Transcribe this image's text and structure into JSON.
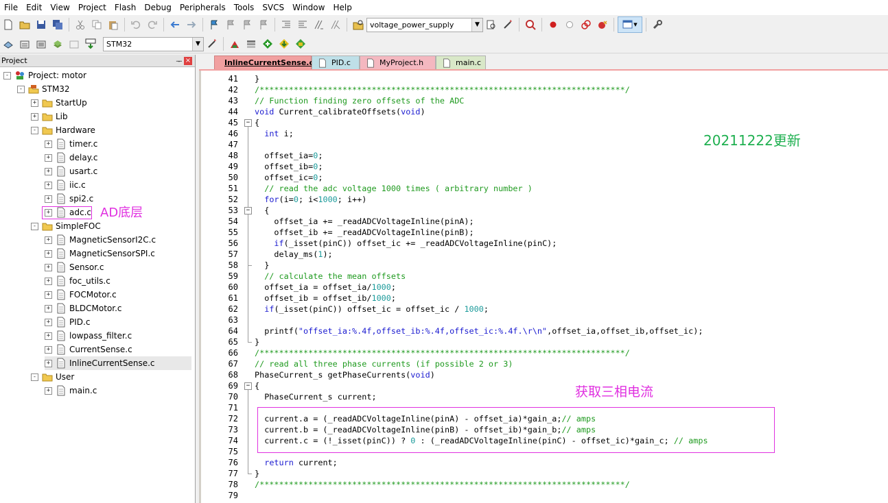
{
  "menu": [
    "File",
    "Edit",
    "View",
    "Project",
    "Flash",
    "Debug",
    "Peripherals",
    "Tools",
    "SVCS",
    "Window",
    "Help"
  ],
  "toolbar1": {
    "target_combo": "voltage_power_supply"
  },
  "toolbar2": {
    "device_combo": "STM32"
  },
  "panel": {
    "title": "Project",
    "pin": "ᅮ",
    "close": "×",
    "tree": [
      {
        "label": "Project: motor",
        "icon": "project-icon",
        "expander": "-",
        "depth": 0
      },
      {
        "label": "STM32",
        "icon": "target-icon",
        "expander": "-",
        "depth": 1
      },
      {
        "label": "StartUp",
        "icon": "folder-icon",
        "expander": "+",
        "depth": 2
      },
      {
        "label": "Lib",
        "icon": "folder-icon",
        "expander": "+",
        "depth": 2
      },
      {
        "label": "Hardware",
        "icon": "folder-icon",
        "expander": "-",
        "depth": 2
      },
      {
        "label": "timer.c",
        "icon": "file-icon",
        "expander": "+",
        "depth": 3
      },
      {
        "label": "delay.c",
        "icon": "file-icon",
        "expander": "+",
        "depth": 3
      },
      {
        "label": "usart.c",
        "icon": "file-icon",
        "expander": "+",
        "depth": 3
      },
      {
        "label": "iic.c",
        "icon": "file-icon",
        "expander": "+",
        "depth": 3
      },
      {
        "label": "spi2.c",
        "icon": "file-icon",
        "expander": "+",
        "depth": 3
      },
      {
        "label": "adc.c",
        "icon": "file-icon",
        "expander": "+",
        "depth": 3
      },
      {
        "label": "SimpleFOC",
        "icon": "folder-icon",
        "expander": "-",
        "depth": 2
      },
      {
        "label": "MagneticSensorI2C.c",
        "icon": "file-icon",
        "expander": "+",
        "depth": 3
      },
      {
        "label": "MagneticSensorSPI.c",
        "icon": "file-icon",
        "expander": "+",
        "depth": 3
      },
      {
        "label": "Sensor.c",
        "icon": "file-icon",
        "expander": "+",
        "depth": 3
      },
      {
        "label": "foc_utils.c",
        "icon": "file-icon",
        "expander": "+",
        "depth": 3
      },
      {
        "label": "FOCMotor.c",
        "icon": "file-icon",
        "expander": "+",
        "depth": 3
      },
      {
        "label": "BLDCMotor.c",
        "icon": "file-icon",
        "expander": "+",
        "depth": 3
      },
      {
        "label": "PID.c",
        "icon": "file-icon",
        "expander": "+",
        "depth": 3
      },
      {
        "label": "lowpass_filter.c",
        "icon": "file-icon",
        "expander": "+",
        "depth": 3
      },
      {
        "label": "CurrentSense.c",
        "icon": "file-icon",
        "expander": "+",
        "depth": 3
      },
      {
        "label": "InlineCurrentSense.c",
        "icon": "file-icon",
        "expander": "+",
        "depth": 3,
        "selected": true
      },
      {
        "label": "User",
        "icon": "folder-icon",
        "expander": "-",
        "depth": 2
      },
      {
        "label": "main.c",
        "icon": "file-icon",
        "expander": "+",
        "depth": 3
      }
    ]
  },
  "annotations": {
    "adc_note": "AD底层",
    "date_note": "20211222更新",
    "phase_note": "获取三相电流"
  },
  "tabs": [
    {
      "label": "InlineCurrentSense.c",
      "active": true,
      "color": "#f1a0a0"
    },
    {
      "label": "PID.c",
      "active": false,
      "color": "#bfe0e8"
    },
    {
      "label": "MyProject.h",
      "active": false,
      "color": "#f4b8c0"
    },
    {
      "label": "main.c",
      "active": false,
      "color": "#d9e8c8"
    }
  ],
  "code": {
    "lines": [
      {
        "n": "41",
        "t": "}"
      },
      {
        "n": "42",
        "t": "/***************************************************************************/"
      },
      {
        "n": "43",
        "t": "// Function finding zero offsets of the ADC"
      },
      {
        "n": "44",
        "t": "void Current_calibrateOffsets(void)"
      },
      {
        "n": "45",
        "t": "{"
      },
      {
        "n": "46",
        "t": "  int i;"
      },
      {
        "n": "47",
        "t": ""
      },
      {
        "n": "48",
        "t": "  offset_ia=0;"
      },
      {
        "n": "49",
        "t": "  offset_ib=0;"
      },
      {
        "n": "50",
        "t": "  offset_ic=0;"
      },
      {
        "n": "51",
        "t": "  // read the adc voltage 1000 times ( arbitrary number )"
      },
      {
        "n": "52",
        "t": "  for(i=0; i<1000; i++)"
      },
      {
        "n": "53",
        "t": "  {"
      },
      {
        "n": "54",
        "t": "    offset_ia += _readADCVoltageInline(pinA);"
      },
      {
        "n": "55",
        "t": "    offset_ib += _readADCVoltageInline(pinB);"
      },
      {
        "n": "56",
        "t": "    if(_isset(pinC)) offset_ic += _readADCVoltageInline(pinC);"
      },
      {
        "n": "57",
        "t": "    delay_ms(1);"
      },
      {
        "n": "58",
        "t": "  }"
      },
      {
        "n": "59",
        "t": "  // calculate the mean offsets"
      },
      {
        "n": "60",
        "t": "  offset_ia = offset_ia/1000;"
      },
      {
        "n": "61",
        "t": "  offset_ib = offset_ib/1000;"
      },
      {
        "n": "62",
        "t": "  if(_isset(pinC)) offset_ic = offset_ic / 1000;"
      },
      {
        "n": "63",
        "t": ""
      },
      {
        "n": "64",
        "t": "  printf(\"offset_ia:%.4f,offset_ib:%.4f,offset_ic:%.4f.\\r\\n\",offset_ia,offset_ib,offset_ic);"
      },
      {
        "n": "65",
        "t": "}"
      },
      {
        "n": "66",
        "t": "/***************************************************************************/"
      },
      {
        "n": "67",
        "t": "// read all three phase currents (if possible 2 or 3)"
      },
      {
        "n": "68",
        "t": "PhaseCurrent_s getPhaseCurrents(void)"
      },
      {
        "n": "69",
        "t": "{"
      },
      {
        "n": "70",
        "t": "  PhaseCurrent_s current;"
      },
      {
        "n": "71",
        "t": ""
      },
      {
        "n": "72",
        "t": "  current.a = (_readADCVoltageInline(pinA) - offset_ia)*gain_a;// amps"
      },
      {
        "n": "73",
        "t": "  current.b = (_readADCVoltageInline(pinB) - offset_ib)*gain_b;// amps"
      },
      {
        "n": "74",
        "t": "  current.c = (!_isset(pinC)) ? 0 : (_readADCVoltageInline(pinC) - offset_ic)*gain_c; // amps"
      },
      {
        "n": "75",
        "t": ""
      },
      {
        "n": "76",
        "t": "  return current;"
      },
      {
        "n": "77",
        "t": "}"
      },
      {
        "n": "78",
        "t": "/***************************************************************************/"
      },
      {
        "n": "79",
        "t": ""
      }
    ]
  },
  "colors": {
    "comment": "#1f9a1f",
    "keyword": "#1a1ad0",
    "number": "#1a9a9a",
    "annotation_magenta": "#e030e0",
    "annotation_green": "#1fb050"
  }
}
